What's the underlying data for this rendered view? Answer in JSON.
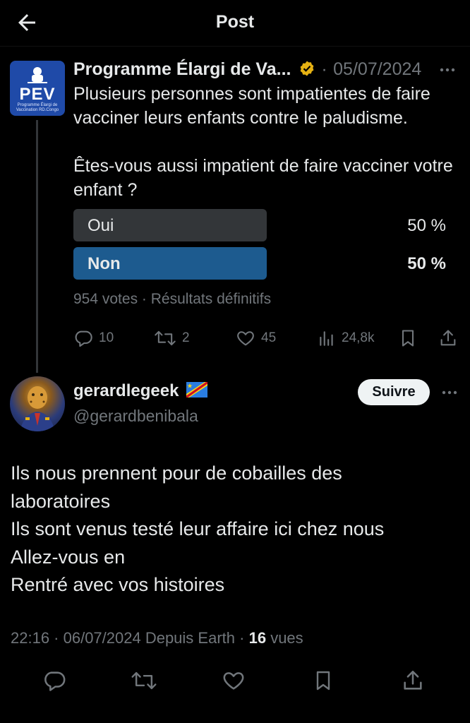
{
  "header": {
    "title": "Post",
    "back_icon": "arrow-left-icon"
  },
  "parent_post": {
    "author_name": "Programme Élargi de Va...",
    "verified_icon": "verified-badge-icon",
    "verified_color": "#e6b213",
    "separator": "·",
    "date": "05/07/2024",
    "avatar": {
      "logo_text": "PEV",
      "logo_subtext": "Programme Élargi de Vaccination RD.Congo",
      "color": "#1f4aa8"
    },
    "text": "Plusieurs personnes sont impatientes de faire vacciner leurs enfants contre le paludisme.\n\nÊtes-vous aussi impatient de faire vacciner votre enfant ?",
    "poll": {
      "options": [
        {
          "label": "Oui",
          "percent": "50 %",
          "share": 0.5,
          "color": "#333639"
        },
        {
          "label": "Non",
          "percent": "50 %",
          "share": 0.5,
          "color": "#1d5b8f",
          "winner": true
        }
      ],
      "meta": "954 votes · Résultats définitifs"
    },
    "actions": {
      "reply_count": "10",
      "repost_count": "2",
      "like_count": "45",
      "views_count": "24,8k"
    }
  },
  "reply": {
    "display_name": "gerardlegeek",
    "handle": "@gerardbenibala",
    "follow_label": "Suivre",
    "flag_icon": "drc-flag-icon",
    "lines": [
      "Ils nous prennent pour de cobailles des",
      "laboratoires",
      "Ils sont venus testé leur affaire ici chez nous",
      "Allez-vous en",
      "Rentré avec vos histoires"
    ],
    "meta": {
      "time_date": "22:16 · 06/07/2024 Depuis Earth ·",
      "views_number": "16",
      "views_label": "vues"
    }
  },
  "colors": {
    "background": "#000000",
    "text": "#e7e9ea",
    "muted": "#71767b",
    "separator": "#333639"
  }
}
